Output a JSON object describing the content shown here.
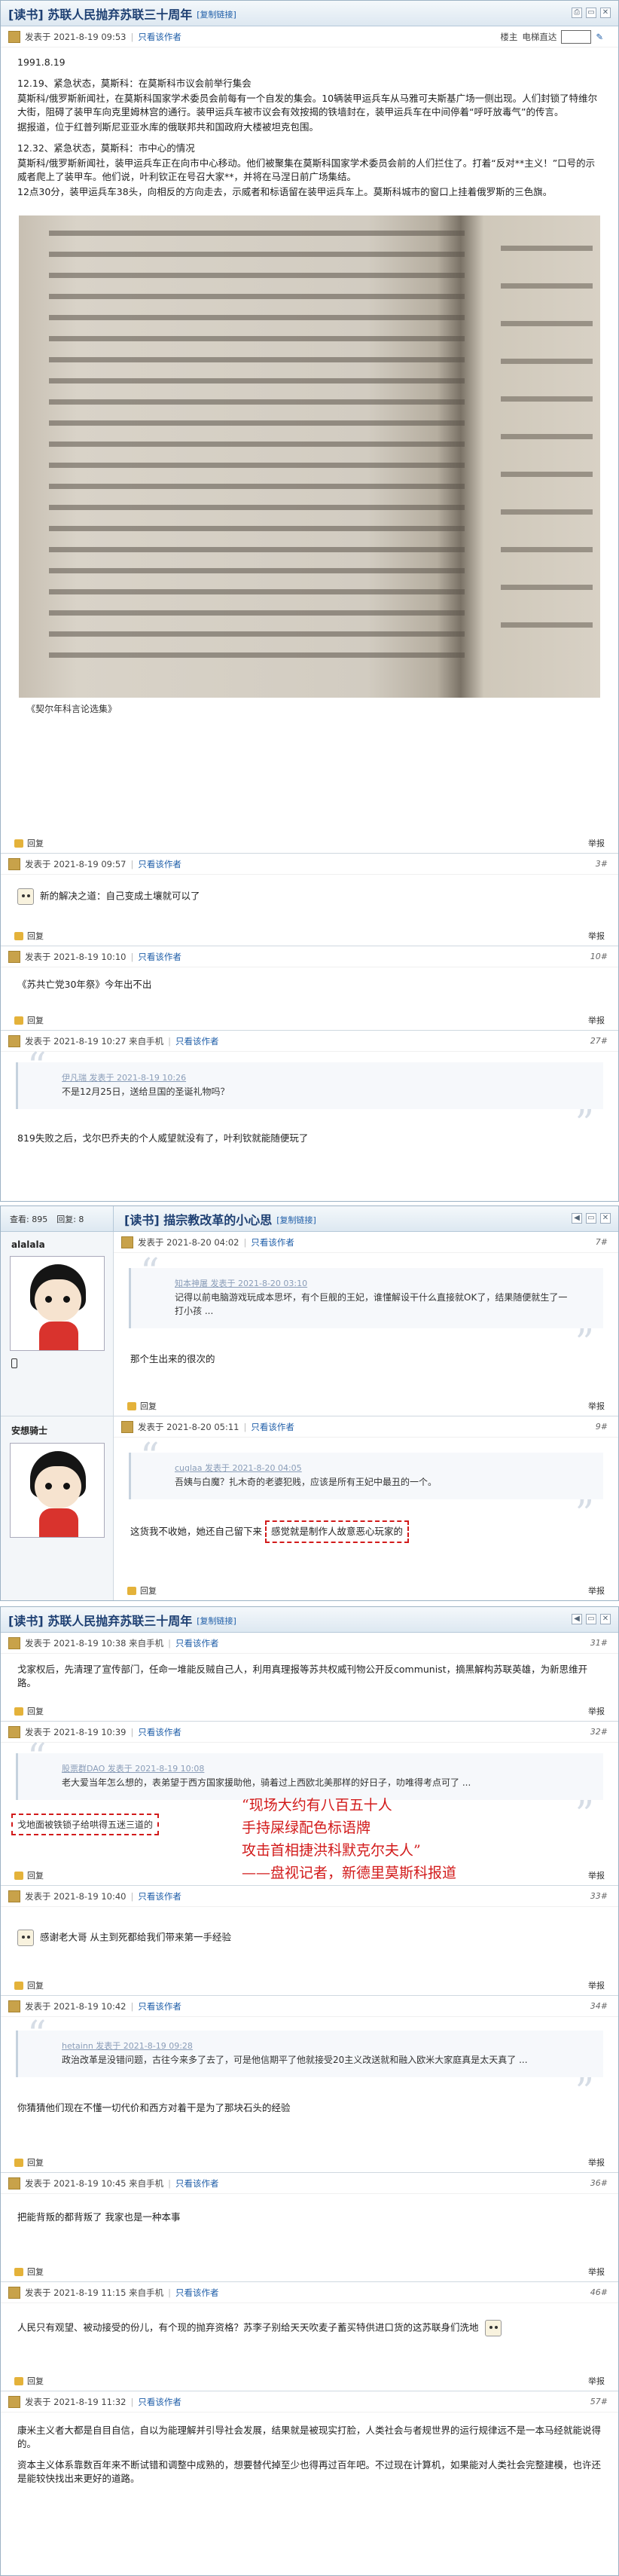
{
  "thread1": {
    "title": "[读书] 苏联人民抛弃苏联三十周年",
    "copy_link": "[复制链接]",
    "header_icons": [
      "print-icon",
      "tab-icon",
      "close-icon"
    ],
    "op": {
      "author": "发表于 2021-8-19 09:53",
      "sep": "|",
      "only_author": "只看该作者",
      "mode_label": "楼主",
      "mode_label2": "电梯直达",
      "paragraphs": [
        "1991.8.19",
        "12.19、紧急状态，莫斯科：在莫斯科市议会前举行集会",
        "莫斯科/俄罗斯新闻社，在莫斯科国家学术委员会前每有一个自发的集会。10辆装甲运兵车从马雅可夫斯基广场一侧出现。人们封锁了特维尔大街，阻碍了装甲车向克里姆林宫的通行。装甲运兵车被市议会有效按揭的铁墙封在，装甲运兵车在中间停着“呼吁放毒气”的传言。",
        "据报道，位于红普列斯尼亚亚水库的俄联邦共和国政府大楼被坦克包围。",
        "12.32、紧急状态，莫斯科：市中心的情况",
        "莫斯科/俄罗斯新闻社，装甲运兵车正在向市中心移动。他们被聚集在莫斯科国家学术委员会前的人们拦住了。打着“反对**主义！”口号的示威者爬上了装甲车。他们说，叶利钦正在号召大家**，并将在马涅日前广场集结。",
        "12点30分，装甲运兵车38头，向相反的方向走去，示威者和标语留在装甲运兵车上。莫斯科城市的窗口上挂着俄罗斯的三色旗。"
      ],
      "caption": "《契尔年科言论选集》",
      "reply": "回复",
      "report": "举报"
    },
    "replies": [
      {
        "author": "发表于 2021-8-19 09:57",
        "only_author": "只看该作者",
        "floor": "3#",
        "text": "新的解决之道：自己变成土壤就可以了",
        "icon": "emoticon-icon"
      },
      {
        "author": "发表于 2021-8-19 10:10",
        "only_author": "只看该作者",
        "floor": "10#",
        "text": "《苏共亡党30年祭》今年出不出"
      },
      {
        "author": "发表于 2021-8-19 10:27 来自手机",
        "only_author": "只看该作者",
        "floor": "27#",
        "quote_author": "伊凡瑞 发表于 2021-8-19 10:26",
        "quote_text": "不是12月25日，送给旦国的圣诞礼物吗？",
        "text": "819失败之后，戈尔巴乔夫的个人威望就没有了，叶利钦就能随便玩了"
      }
    ]
  },
  "thread2": {
    "title": "[读书] 描宗教改革的小心思",
    "copy_link": "[复制链接]",
    "stats_view": "查看: 895",
    "stats_reply": "回复: 8",
    "posts": [
      {
        "user": "alalala",
        "author": "发表于 2021-8-20 04:02",
        "only_author": "只看该作者",
        "floor": "7#",
        "quote_author": "知本神屠 发表于 2021-8-20 03:10",
        "quote_text": "记得以前电脑游戏玩成本思坏，有个巨舰的王妃，谁懂解设干什么直接就OK了，结果随便就生了一打小孩 ...",
        "text": "那个生出来的很次的"
      },
      {
        "user": "安想骑士",
        "author": "发表于 2021-8-20 05:11",
        "only_author": "只看该作者",
        "floor": "9#",
        "quote_author": "cuglaa 发表于 2021-8-20 04:05",
        "quote_text": "吾姨与白魔？扎木奇的老婆犯贱，应该是所有王妃中最丑的一个。",
        "text": "这货我不收她，她还自己留下来",
        "highlight": "感觉就是制作人故意恶心玩家的"
      }
    ]
  },
  "thread3": {
    "title": "[读书] 苏联人民抛弃苏联三十周年",
    "copy_link": "[复制链接]",
    "posts": [
      {
        "author": "发表于 2021-8-19 10:38 来自手机",
        "only_author": "只看该作者",
        "floor": "31#",
        "text": "戈家权后，先清理了宣传部门，任命一堆能反贼自己人，利用真理报等苏共权威刊物公开反communist，摘黑解构苏联英雄，为新思维开路。"
      },
      {
        "author": "发表于 2021-8-19 10:39",
        "only_author": "只看该作者",
        "floor": "32#",
        "quote_author": "股票群DAO 发表于 2021-8-19 10:08",
        "quote_text": "老大爱当年怎么想的，表弟望于西方国家援助他，骑着过上西欧北美那样的好日子，叻唯得考点可了 ...",
        "highlight": "戈地面被铁锁子给哄得五迷三道的",
        "annotation_lines": [
          "“现场大约有八百五十人",
          "手持屎绿配色标语牌",
          "攻击首相捷洪科默克尔夫人”",
          "——盘视记者，新德里莫斯科报道"
        ]
      },
      {
        "author": "发表于 2021-8-19 10:40",
        "only_author": "只看该作者",
        "floor": "33#",
        "text": "感谢老大哥 从主到死都给我们带来第一手经验",
        "icon": "emoticon-icon"
      },
      {
        "author": "发表于 2021-8-19 10:42",
        "only_author": "只看该作者",
        "floor": "34#",
        "quote_author": "hetainn 发表于 2021-8-19 09:28",
        "quote_text": "政治改革是没错问题，古往今来多了去了，可是他信期平了他就接受20主义改送就和融入欧米大家庭真是太天真了 ...",
        "text": "你猜猜他们现在不懂一切代价和西方对着干是为了那块石头的经验"
      },
      {
        "author": "发表于 2021-8-19 10:45 来自手机",
        "only_author": "只看该作者",
        "floor": "36#",
        "text": "把能背叛的都背叛了 我家也是一种本事"
      },
      {
        "author": "发表于 2021-8-19 11:15 来自手机",
        "only_author": "只看该作者",
        "floor": "46#",
        "text": "人民只有观望、被动接受的份儿，有个现的抛弃资格？苏李子别给天天吹麦子蓄买特供进口货的这苏联身们洗地",
        "icon": "emoticon-icon"
      },
      {
        "author": "发表于 2021-8-19 11:32",
        "only_author": "只看该作者",
        "floor": "57#",
        "text": "康米主义者大都是自目自信，自以为能理解并引导社会发展，结果就是被现实打脸，人类社会与者规世界的运行规律远不是一本马经就能说得的。",
        "text2": "资本主义体系靠数百年来不断试错和调整中成熟的，想要替代掉至少也得再过百年吧。不过现在计算机，如果能对人类社会完整建模，也许还是能较快找出来更好的道路。"
      }
    ]
  },
  "footer_common": {
    "reply": "回复",
    "report": "举报"
  }
}
